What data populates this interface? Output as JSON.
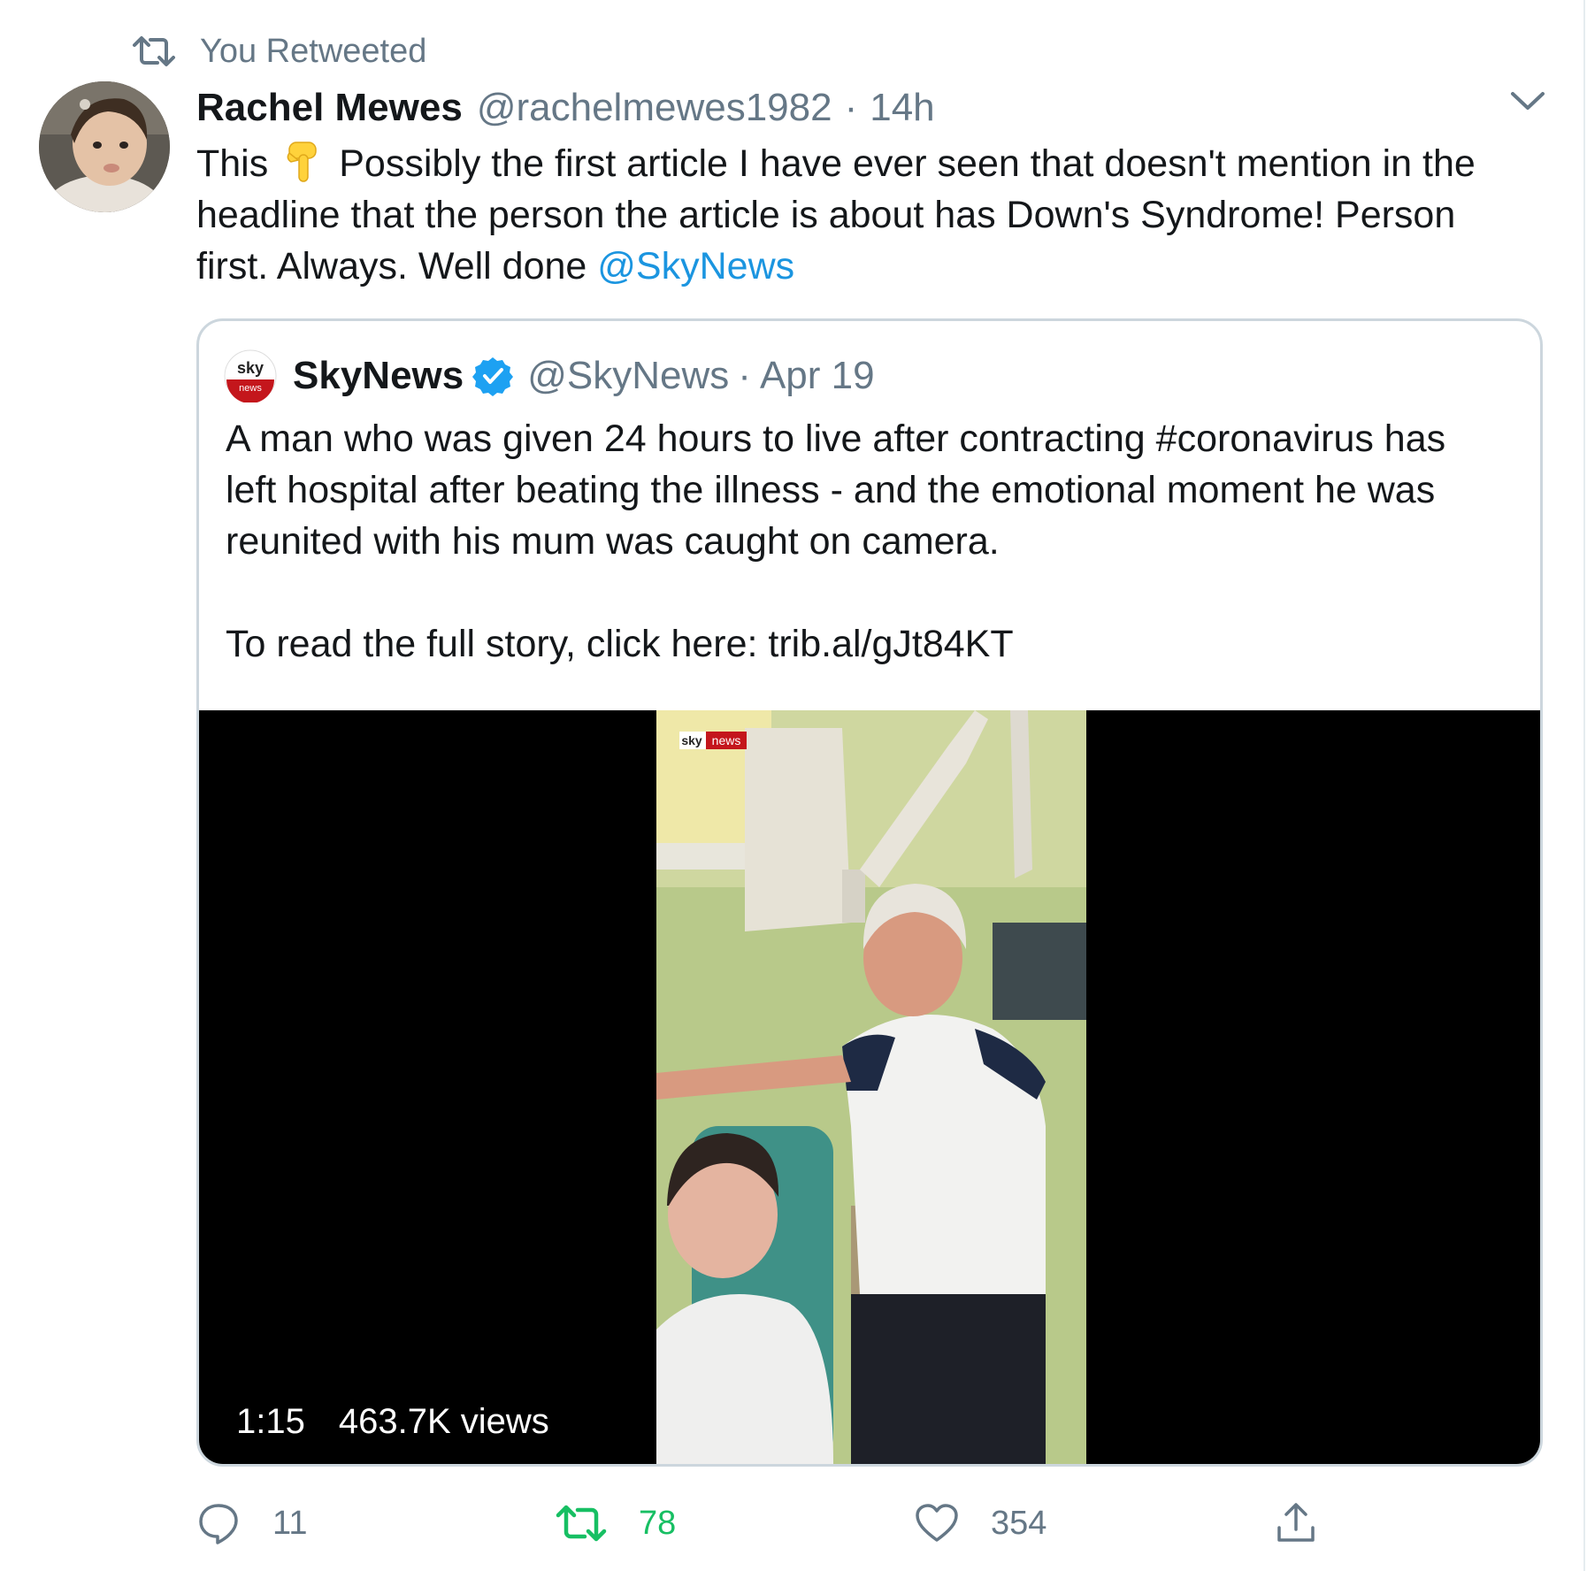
{
  "retweet_context": {
    "label": "You Retweeted"
  },
  "tweet": {
    "author_name": "Rachel Mewes",
    "author_handle": "@rachelmewes1982",
    "separator": "·",
    "time": "14h",
    "text_lines": [
      {
        "before": "This",
        "emoji": "backhand-index-pointing-down",
        "after": "Possibly the first article I have ever seen that doesn't mention in the"
      },
      {
        "text": "headline that the person the article is about has Down's Syndrome! Person"
      },
      {
        "text": "first. Always. Well done ",
        "mention": "@SkyNews"
      }
    ]
  },
  "quoted_tweet": {
    "name": "SkyNews",
    "verified": true,
    "handle": "@SkyNews",
    "separator": "·",
    "date": "Apr 19",
    "lines": [
      "A man who was given 24 hours to live after contracting #coronavirus has",
      "left hospital after beating the illness - and the emotional moment he was",
      "reunited with his mum was caught on camera.",
      "To read the full story, click here: trib.al/gJt84KT"
    ],
    "video": {
      "watermark_left": "sky",
      "watermark_right": "news",
      "duration": "1:15",
      "views": "463.7K views"
    }
  },
  "actions": {
    "reply_count": "11",
    "retweet_count": "78",
    "like_count": "354"
  },
  "colors": {
    "link": "#1b95e0",
    "muted": "#657786",
    "retweeted": "#17bf63",
    "border": "#ccd6dd"
  },
  "icons": [
    "retweet-icon",
    "chevron-down-icon",
    "backhand-index-pointing-down-icon",
    "verified-badge-icon",
    "reply-icon",
    "retweet-icon",
    "heart-icon",
    "share-icon"
  ]
}
